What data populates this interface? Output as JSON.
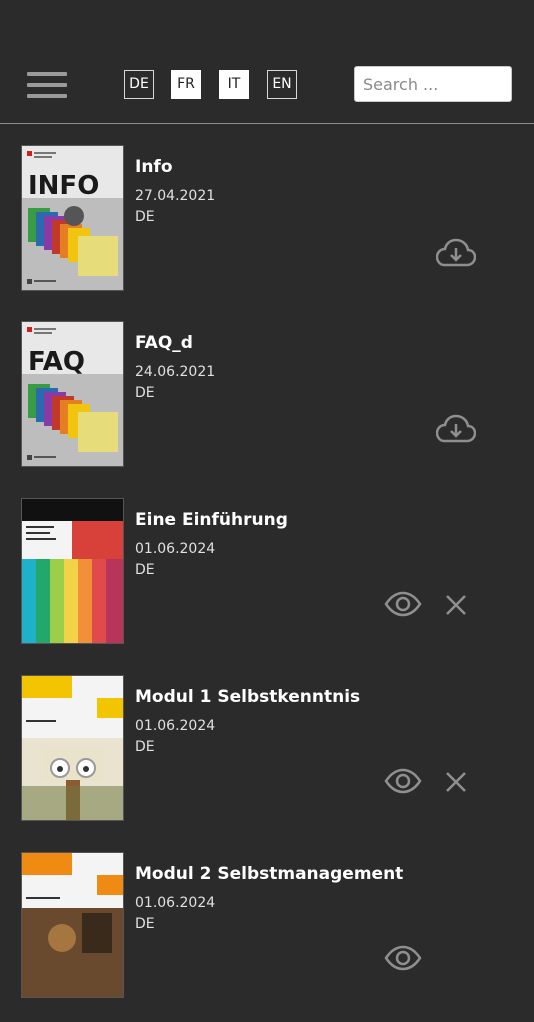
{
  "header": {
    "languages": [
      {
        "code": "DE",
        "active": false
      },
      {
        "code": "FR",
        "active": true
      },
      {
        "code": "IT",
        "active": true
      },
      {
        "code": "EN",
        "active": false
      }
    ],
    "search_placeholder": "Search ..."
  },
  "documents": [
    {
      "title": "Info",
      "date": "27.04.2021",
      "language": "DE",
      "cover_text": "INFO",
      "status": "download"
    },
    {
      "title": "FAQ_d",
      "date": "24.06.2021",
      "language": "DE",
      "cover_text": "FAQ",
      "status": "download"
    },
    {
      "title": "Eine Einführung",
      "date": "01.06.2024",
      "language": "DE",
      "cover_text": "",
      "status": "downloaded"
    },
    {
      "title": "Modul 1 Selbstkenntnis",
      "date": "01.06.2024",
      "language": "DE",
      "cover_text": "",
      "status": "downloaded"
    },
    {
      "title": "Modul 2 Selbstmanagement",
      "date": "01.06.2024",
      "language": "DE",
      "cover_text": "",
      "status": "downloaded"
    }
  ],
  "colors": {
    "background": "#2b2b2b",
    "icon": "#8f8f8f",
    "text": "#ffffff"
  }
}
